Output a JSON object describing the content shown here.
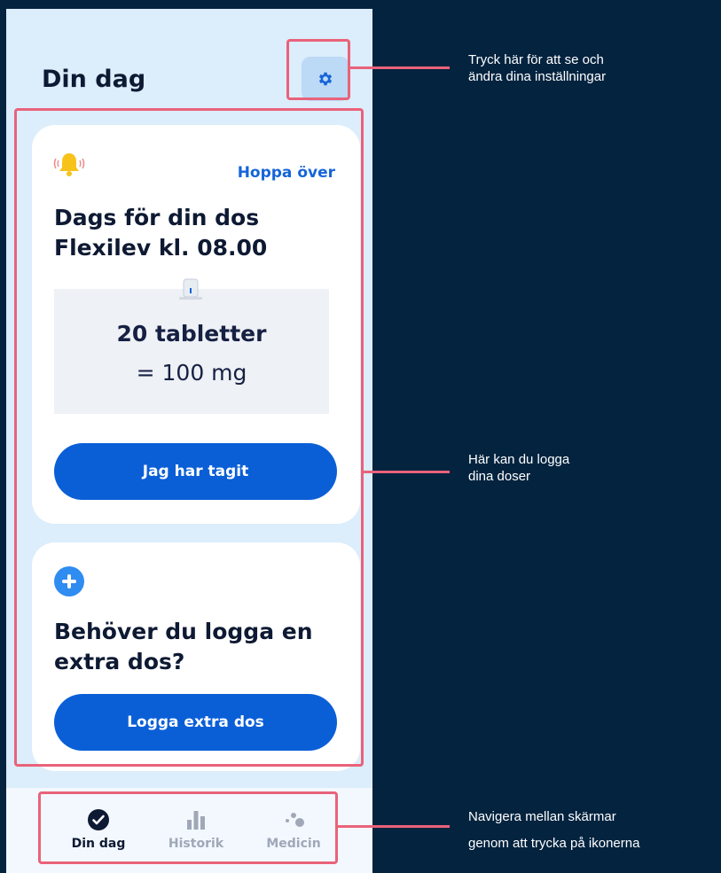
{
  "header": {
    "title": "Din dag"
  },
  "dose_card": {
    "skip_label": "Hoppa över",
    "title_line1": "Dags för din dos",
    "title_line2": "Flexilev kl. 08.00",
    "count": "20 tabletter",
    "amount": "= 100 mg",
    "confirm_label": "Jag har tagit"
  },
  "extra_card": {
    "title_line1": "Behöver du logga en",
    "title_line2": "extra dos?",
    "button_label": "Logga extra dos"
  },
  "nav": [
    {
      "label": "Din dag",
      "icon": "check-circle-icon",
      "active": true
    },
    {
      "label": "Historik",
      "icon": "bar-chart-icon",
      "active": false
    },
    {
      "label": "Medicin",
      "icon": "dots-icon",
      "active": false
    }
  ],
  "annotations": {
    "settings_line1": "Tryck här för att se och",
    "settings_line2": "ändra dina inställningar",
    "cards_line1": "Här kan du logga",
    "cards_line2": "dina doser",
    "nav_line1": "Navigera mellan skärmar",
    "nav_line2": "genom att trycka på ikonerna"
  },
  "colors": {
    "background": "#03233f",
    "accent": "#0a5fd7",
    "link": "#1565d8",
    "highlight": "#e9627a",
    "bell": "#f7c31a"
  }
}
